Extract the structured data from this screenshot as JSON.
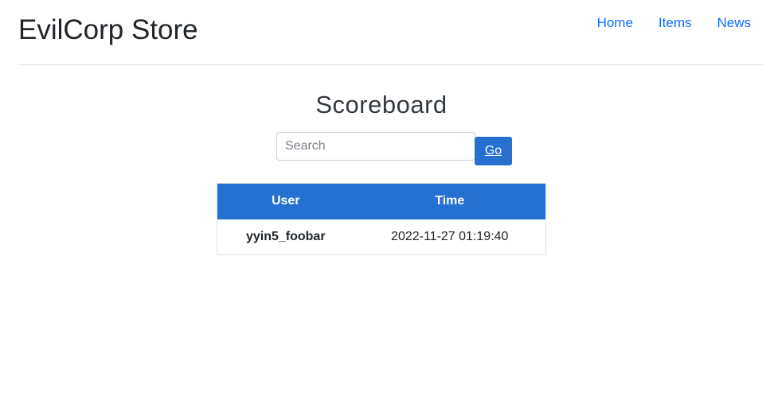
{
  "header": {
    "brand": "EvilCorp Store",
    "nav": [
      {
        "label": "Home"
      },
      {
        "label": "Items"
      },
      {
        "label": "News"
      }
    ]
  },
  "main": {
    "title": "Scoreboard",
    "search": {
      "placeholder": "Search",
      "value": "",
      "button_label": "Go"
    },
    "table": {
      "headers": [
        "User",
        "Time"
      ],
      "rows": [
        {
          "user": "yyin5_foobar",
          "time": "2022-11-27 01:19:40"
        }
      ]
    }
  },
  "colors": {
    "accent": "#2670d1",
    "link": "#0d6efd"
  }
}
